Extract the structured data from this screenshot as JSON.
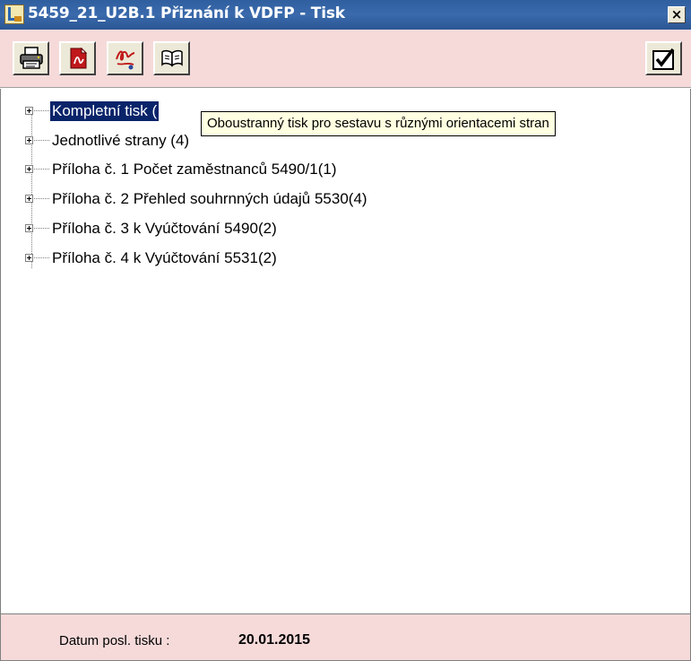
{
  "window": {
    "title": "5459_21_U2B.1 Přiznání k VDFP - Tisk",
    "close_label": "×",
    "app_icon": "app-icon"
  },
  "toolbar": {
    "buttons": [
      {
        "name": "print-icon"
      },
      {
        "name": "pdf-icon"
      },
      {
        "name": "signature-icon"
      },
      {
        "name": "duplex-print-icon"
      },
      {
        "name": "checkmark-icon"
      }
    ]
  },
  "tree": {
    "nodes": [
      {
        "label": "Kompletní tisk (",
        "selected": true
      },
      {
        "label": "Jednotlivé strany (4)"
      },
      {
        "label": "Příloha č. 1 Počet zaměstnanců 5490/1(1)"
      },
      {
        "label": "Příloha č. 2 Přehled souhrnných údajů 5530(4)"
      },
      {
        "label": "Příloha č. 3 k Vyúčtování 5490(2)"
      },
      {
        "label": "Příloha č. 4 k Vyúčtování 5531(2)"
      }
    ]
  },
  "tooltip": {
    "text": "Oboustranný tisk pro sestavu s různými orientacemi stran"
  },
  "status": {
    "label": "Datum posl. tisku :",
    "value": "20.01.2015"
  },
  "colors": {
    "titlebar": "#3a6aac",
    "panel": "#f6dada",
    "selection": "#0a246a",
    "tooltip_bg": "#ffffe1"
  }
}
